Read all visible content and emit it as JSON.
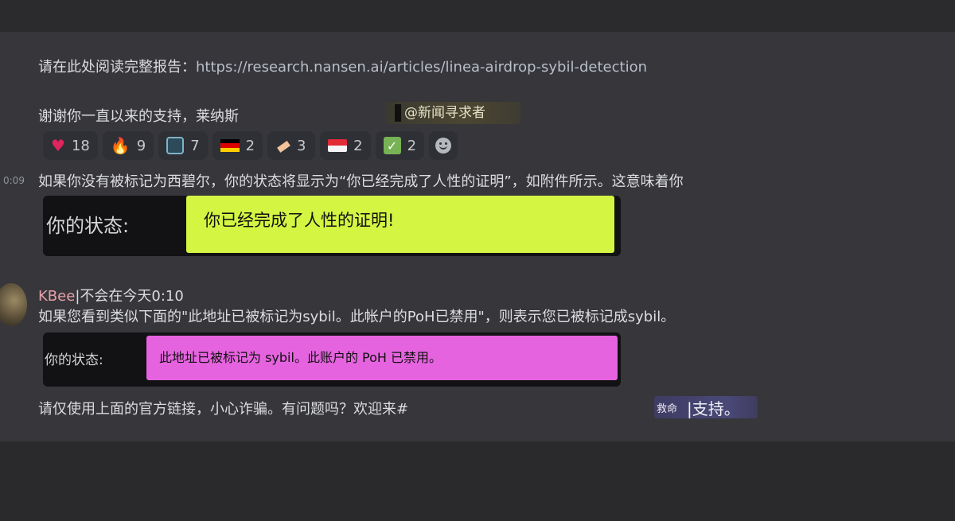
{
  "message1": {
    "report_prefix": "请在此处阅读完整报告：",
    "report_link": "https://research.nansen.ai/articles/linea-airdrop-sybil-detection",
    "thanks": "谢谢你一直以来的支持，莱纳斯",
    "mention": "@新闻寻求者"
  },
  "reactions": [
    {
      "icon": "heart-icon",
      "count": "18"
    },
    {
      "icon": "fire-icon",
      "count": "9"
    },
    {
      "icon": "robot-icon",
      "count": "7"
    },
    {
      "icon": "germany-flag-icon",
      "count": "2"
    },
    {
      "icon": "bandage-icon",
      "count": "3"
    },
    {
      "icon": "indonesia-flag-icon",
      "count": "2"
    },
    {
      "icon": "check-mark-icon",
      "count": "2"
    },
    {
      "icon": "add-reaction-icon"
    }
  ],
  "message2": {
    "timestamp": "0:09",
    "text": "如果你没有被标记为西碧尔，你的状态将显示为“你已经完成了人性的证明”，如附件所示。这意味着你",
    "card_label": "你的状态:",
    "card_value": "你已经完成了人性的证明!"
  },
  "message3": {
    "username": "KBee",
    "username_suffix": "|不会在今天0:10",
    "text": "如果您看到类似下面的\"此地址已被标记为sybil。此帐户的PoH已禁用\"，则表示您已被标记成sybil。",
    "card_label": "你的状态:",
    "card_value": "此地址已被标记为 sybil。此账户的 PoH 已禁用。",
    "footer": "请仅使用上面的官方链接，小心诈骗。有问题吗？欢迎来#",
    "help_tag_a": "救命",
    "help_tag_b": "|支持。"
  },
  "colors": {
    "background": "#36363b",
    "success_pill": "#d4f542",
    "sybil_pill": "#e663e0",
    "username": "#e8a0a8"
  }
}
